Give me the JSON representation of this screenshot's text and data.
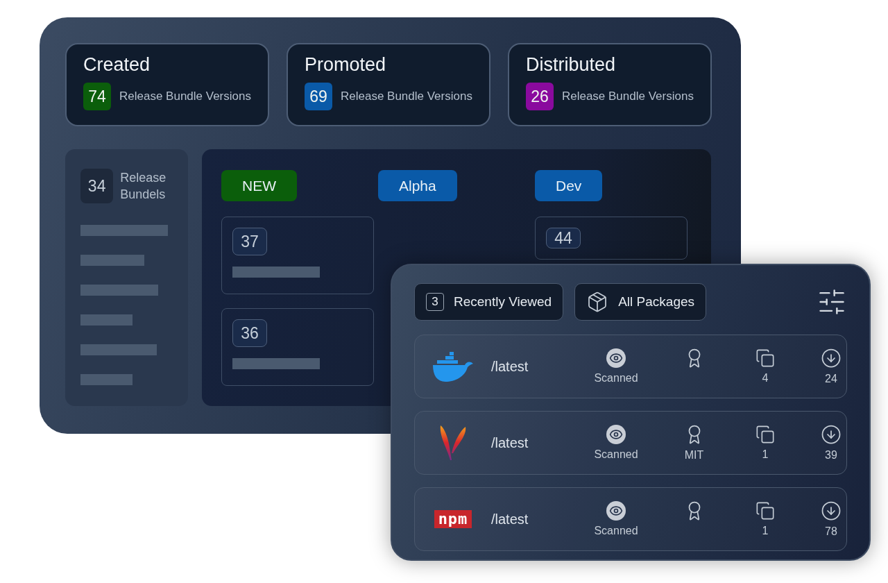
{
  "stats": [
    {
      "title": "Created",
      "count": "74",
      "label": "Release Bundle Versions",
      "color": "#0b5e0b"
    },
    {
      "title": "Promoted",
      "count": "69",
      "label": "Release Bundle Versions",
      "color": "#0a5aa8"
    },
    {
      "title": "Distributed",
      "count": "26",
      "label": "Release Bundle Versions",
      "color": "#8a0a9e"
    }
  ],
  "bundles": {
    "count": "34",
    "label": "Release Bundels"
  },
  "stages": [
    {
      "label": "NEW",
      "color": "#0b5e0b",
      "cards": [
        {
          "kind": "full",
          "count": "37"
        },
        {
          "kind": "full",
          "count": "36"
        }
      ]
    },
    {
      "label": "Alpha",
      "color": "#0a5aa8"
    },
    {
      "label": "Dev",
      "color": "#0a5aa8",
      "cards": [
        {
          "kind": "peek",
          "count": "44"
        }
      ]
    }
  ],
  "packages": {
    "tabs": [
      {
        "kind": "count",
        "count": "3",
        "label": "Recently Viewed"
      },
      {
        "kind": "icon",
        "label": "All Packages"
      }
    ],
    "rows": [
      {
        "logo": {
          "kind": "whale"
        },
        "path": "/latest",
        "scan": "Scanned",
        "files": "4",
        "downloads": "24"
      },
      {
        "logo": {
          "kind": "feather"
        },
        "path": "/latest",
        "scan": "Scanned",
        "license": "MIT",
        "files": "1",
        "downloads": "39"
      },
      {
        "logo": {
          "kind": "wordmark",
          "text": "npm"
        },
        "path": "/latest",
        "scan": "Scanned",
        "files": "1",
        "downloads": "78"
      }
    ]
  }
}
